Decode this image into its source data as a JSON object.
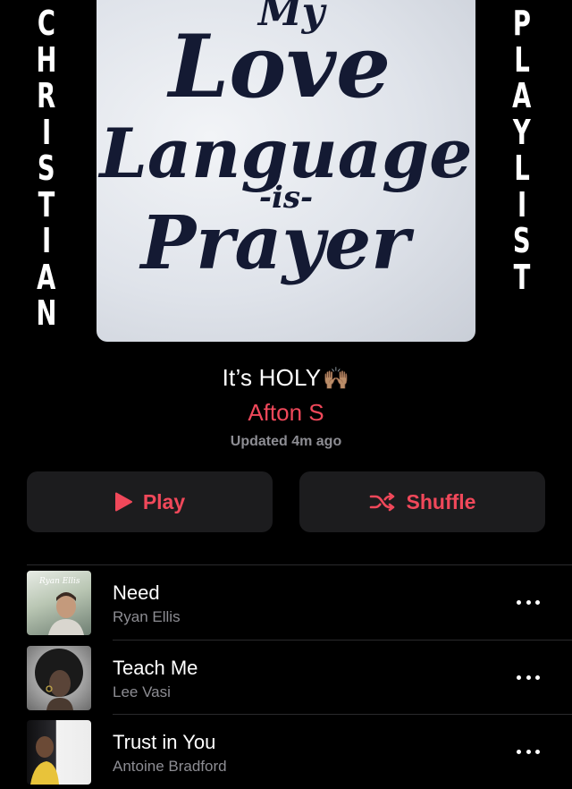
{
  "side_text": {
    "left": [
      "C",
      "H",
      "R",
      "I",
      "S",
      "T",
      "I",
      "A",
      "N"
    ],
    "right": [
      "P",
      "L",
      "A",
      "Y",
      "L",
      "I",
      "S",
      "T"
    ]
  },
  "cover": {
    "lines": [
      "My",
      "Love",
      "Language",
      "-is-",
      "Prayer"
    ]
  },
  "playlist": {
    "title": "It’s HOLY",
    "title_emoji": "🙌🏽",
    "author": "Afton S",
    "updated": "Updated 4m ago"
  },
  "buttons": {
    "play_label": "Play",
    "shuffle_label": "Shuffle"
  },
  "songs": [
    {
      "title": "Need",
      "artist": "Ryan Ellis",
      "thumb_caption": "Ryan Ellis"
    },
    {
      "title": "Teach Me",
      "artist": "Lee Vasi"
    },
    {
      "title": "Trust in You",
      "artist": "Antoine Bradford"
    }
  ],
  "colors": {
    "accent": "#f0485a",
    "background": "#000000",
    "button_bg": "#1c1c1e",
    "secondary_text": "#8d8d93",
    "cover_ink": "#141a33"
  }
}
